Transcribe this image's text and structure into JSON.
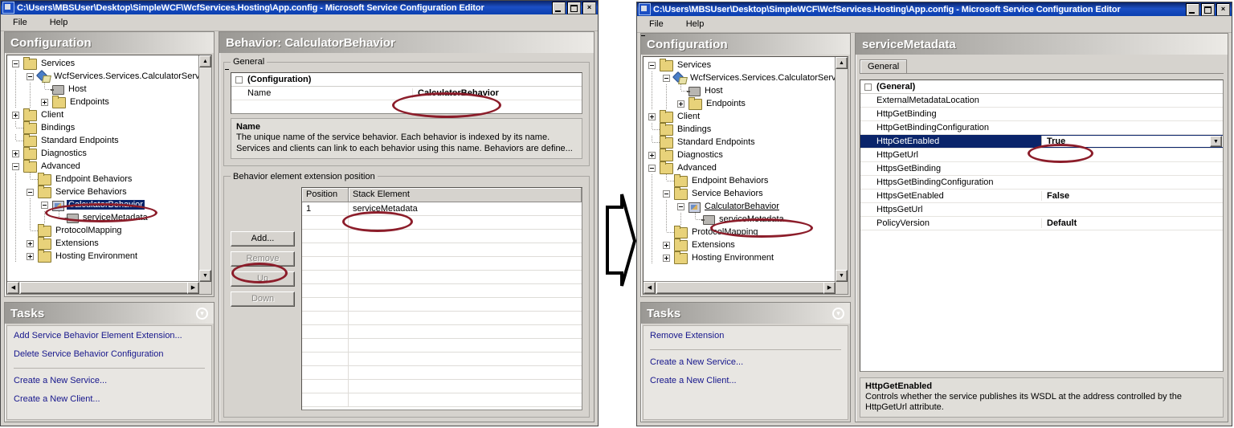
{
  "window": {
    "title": "C:\\Users\\MBSUser\\Desktop\\SimpleWCF\\WcfServices.Hosting\\App.config - Microsoft Service Configuration Editor",
    "menu": [
      "File",
      "Help"
    ],
    "buttons": {
      "minimize": "_",
      "maximize": "□",
      "close": "×"
    }
  },
  "panels": {
    "configuration_title": "Configuration",
    "tasks_title": "Tasks"
  },
  "left": {
    "content_title": "Behavior: CalculatorBehavior",
    "tree": [
      {
        "label": "Services",
        "indent": 0,
        "toggle": "minus",
        "icon": "folder-icon"
      },
      {
        "label": "WcfServices.Services.CalculatorServ",
        "indent": 1,
        "toggle": "minus",
        "icon": "service-icon"
      },
      {
        "label": "Host",
        "indent": 2,
        "toggle": "none",
        "icon": "element-icon"
      },
      {
        "label": "Endpoints",
        "indent": 2,
        "toggle": "plus",
        "icon": "folder-icon"
      },
      {
        "label": "Client",
        "indent": 0,
        "toggle": "plus",
        "icon": "folder-icon"
      },
      {
        "label": "Bindings",
        "indent": 0,
        "toggle": "none",
        "icon": "folder-icon"
      },
      {
        "label": "Standard Endpoints",
        "indent": 0,
        "toggle": "none",
        "icon": "folder-icon"
      },
      {
        "label": "Diagnostics",
        "indent": 0,
        "toggle": "plus",
        "icon": "folder-icon"
      },
      {
        "label": "Advanced",
        "indent": 0,
        "toggle": "minus",
        "icon": "folder-icon"
      },
      {
        "label": "Endpoint Behaviors",
        "indent": 1,
        "toggle": "none",
        "icon": "folder-icon"
      },
      {
        "label": "Service Behaviors",
        "indent": 1,
        "toggle": "minus",
        "icon": "folder-icon"
      },
      {
        "label": "CalculatorBehavior",
        "indent": 2,
        "toggle": "minus",
        "icon": "behavior-icon",
        "state": "selected"
      },
      {
        "label": "serviceMetadata",
        "indent": 3,
        "toggle": "none",
        "icon": "element-icon"
      },
      {
        "label": "ProtocolMapping",
        "indent": 1,
        "toggle": "none",
        "icon": "folder-icon"
      },
      {
        "label": "Extensions",
        "indent": 1,
        "toggle": "plus",
        "icon": "folder-icon"
      },
      {
        "label": "Hosting Environment",
        "indent": 1,
        "toggle": "plus",
        "icon": "folder-icon"
      }
    ],
    "general": {
      "legend": "General",
      "group_row": "(Configuration)",
      "name_label": "Name",
      "name_value": "CalculatorBehavior"
    },
    "help": {
      "title": "Name",
      "body": "The unique name of the service behavior. Each behavior is indexed by its name. Services and clients can link to each behavior using this name. Behaviors are define..."
    },
    "extension": {
      "legend": "Behavior element extension position",
      "columns": [
        "Position",
        "Stack Element"
      ],
      "rows": [
        {
          "position": "1",
          "stack_element": "serviceMetadata"
        }
      ],
      "buttons": [
        {
          "label": "Add...",
          "enabled": true
        },
        {
          "label": "Remove",
          "enabled": false
        },
        {
          "label": "Up",
          "enabled": false
        },
        {
          "label": "Down",
          "enabled": false
        }
      ]
    },
    "tasks": [
      "Add Service Behavior Element Extension...",
      "Delete Service Behavior Configuration",
      "Create a New Service...",
      "Create a New Client..."
    ],
    "tasks_separator_after": 1
  },
  "right": {
    "content_title": "serviceMetadata",
    "tab": "General",
    "tree": [
      {
        "label": "Services",
        "indent": 0,
        "toggle": "minus",
        "icon": "folder-icon"
      },
      {
        "label": "WcfServices.Services.CalculatorServ",
        "indent": 1,
        "toggle": "minus",
        "icon": "service-icon"
      },
      {
        "label": "Host",
        "indent": 2,
        "toggle": "none",
        "icon": "element-icon"
      },
      {
        "label": "Endpoints",
        "indent": 2,
        "toggle": "plus",
        "icon": "folder-icon"
      },
      {
        "label": "Client",
        "indent": 0,
        "toggle": "plus",
        "icon": "folder-icon"
      },
      {
        "label": "Bindings",
        "indent": 0,
        "toggle": "none",
        "icon": "folder-icon"
      },
      {
        "label": "Standard Endpoints",
        "indent": 0,
        "toggle": "none",
        "icon": "folder-icon"
      },
      {
        "label": "Diagnostics",
        "indent": 0,
        "toggle": "plus",
        "icon": "folder-icon"
      },
      {
        "label": "Advanced",
        "indent": 0,
        "toggle": "minus",
        "icon": "folder-icon"
      },
      {
        "label": "Endpoint Behaviors",
        "indent": 1,
        "toggle": "none",
        "icon": "folder-icon"
      },
      {
        "label": "Service Behaviors",
        "indent": 1,
        "toggle": "minus",
        "icon": "folder-icon"
      },
      {
        "label": "CalculatorBehavior",
        "indent": 2,
        "toggle": "minus",
        "icon": "behavior-icon",
        "state": "link"
      },
      {
        "label": "serviceMetadata",
        "indent": 3,
        "toggle": "none",
        "icon": "element-icon"
      },
      {
        "label": "ProtocolMapping",
        "indent": 1,
        "toggle": "none",
        "icon": "folder-icon"
      },
      {
        "label": "Extensions",
        "indent": 1,
        "toggle": "plus",
        "icon": "folder-icon"
      },
      {
        "label": "Hosting Environment",
        "indent": 1,
        "toggle": "plus",
        "icon": "folder-icon"
      }
    ],
    "properties": {
      "group_row": "(General)",
      "rows": [
        {
          "name": "ExternalMetadataLocation",
          "value": ""
        },
        {
          "name": "HttpGetBinding",
          "value": ""
        },
        {
          "name": "HttpGetBindingConfiguration",
          "value": ""
        },
        {
          "name": "HttpGetEnabled",
          "value": "True",
          "state": "selected",
          "dropdown": true
        },
        {
          "name": "HttpGetUrl",
          "value": ""
        },
        {
          "name": "HttpsGetBinding",
          "value": ""
        },
        {
          "name": "HttpsGetBindingConfiguration",
          "value": ""
        },
        {
          "name": "HttpsGetEnabled",
          "value": "False"
        },
        {
          "name": "HttpsGetUrl",
          "value": ""
        },
        {
          "name": "PolicyVersion",
          "value": "Default"
        }
      ]
    },
    "help": {
      "title": "HttpGetEnabled",
      "body": "Controls whether the service publishes its WSDL at the address controlled by the HttpGetUrl attribute."
    },
    "tasks": [
      "Remove Extension",
      "Create a New Service...",
      "Create a New Client..."
    ],
    "tasks_separator_after": 0
  },
  "colors": {
    "annotation": "#8c1d2a",
    "selection": "#0a246a",
    "link": "#16168c",
    "window_face": "#d6d3ce"
  }
}
